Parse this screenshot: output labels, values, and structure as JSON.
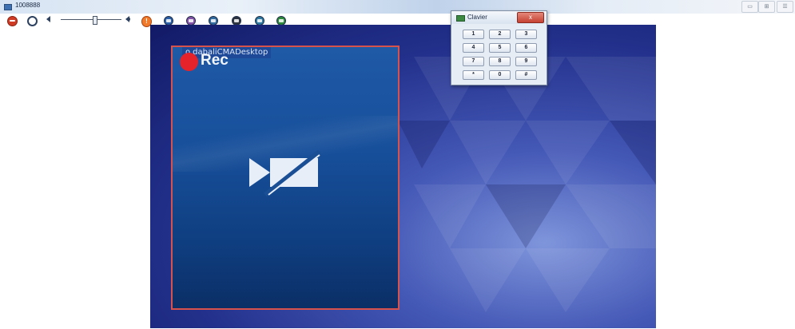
{
  "window": {
    "title": "1008888",
    "controls": {
      "minimize": "▭",
      "maximize": "⊞",
      "close": "☰"
    }
  },
  "toolbar": {
    "icons": [
      "hangup-icon",
      "ring-icon",
      "speaker-icon",
      "volume-slider",
      "speaker-on-icon",
      "alert-icon",
      "record-icon",
      "user-icon",
      "screen-share-icon",
      "settings-icon",
      "camera-icon",
      "chat-icon"
    ],
    "alert_glyph": "!",
    "volume_level": 0.55
  },
  "video": {
    "camera_caption": "o.dabaliCMADesktop",
    "rec_label": "Rec",
    "colors": {
      "frame_border": "#d7524b",
      "rec_dot": "#e6232a"
    }
  },
  "keypad": {
    "title": "Clavier",
    "close_glyph": "x",
    "keys": [
      [
        "1",
        "2",
        "3"
      ],
      [
        "4",
        "5",
        "6"
      ],
      [
        "7",
        "8",
        "9"
      ],
      [
        "*",
        "0",
        "#"
      ]
    ]
  }
}
